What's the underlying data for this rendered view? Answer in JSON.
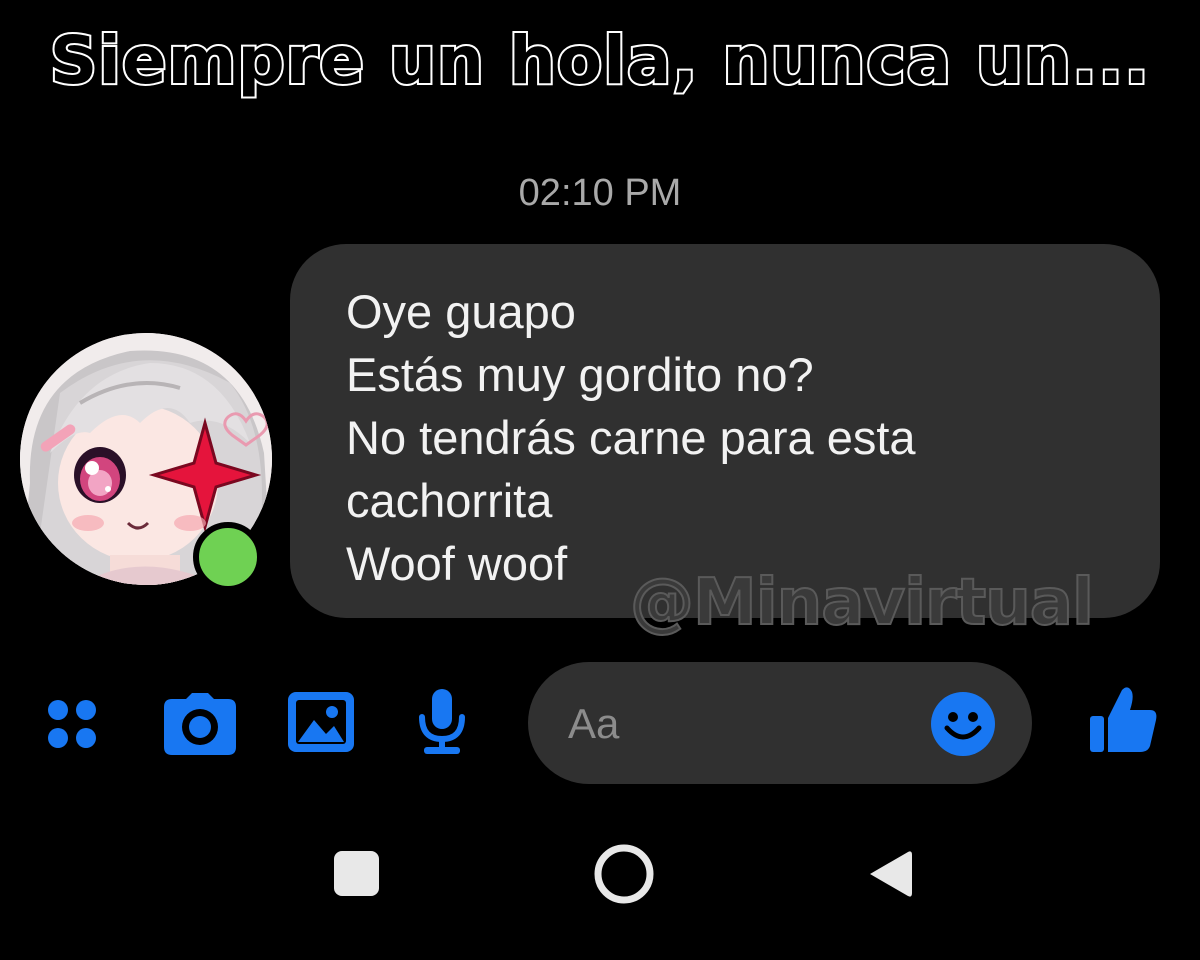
{
  "caption": "Siempre un hola, nunca un...",
  "chat": {
    "timestamp": "02:10 PM",
    "message_lines": [
      "Oye guapo",
      "Estás muy gordito no?",
      "No tendrás carne para esta",
      "cachorrita",
      "Woof woof"
    ],
    "sender_status": "online"
  },
  "watermark": "@Minavirtual",
  "composer": {
    "placeholder": "Aa"
  },
  "toolbar": {
    "icons": [
      "apps-icon",
      "camera-icon",
      "gallery-icon",
      "microphone-icon",
      "emoji-icon",
      "like-icon"
    ]
  },
  "colors": {
    "accent": "#1877f2",
    "bubble": "#303030",
    "online": "#6fd153",
    "background": "#000000"
  },
  "nav": {
    "buttons": [
      "recents-icon",
      "home-icon",
      "back-icon"
    ]
  }
}
